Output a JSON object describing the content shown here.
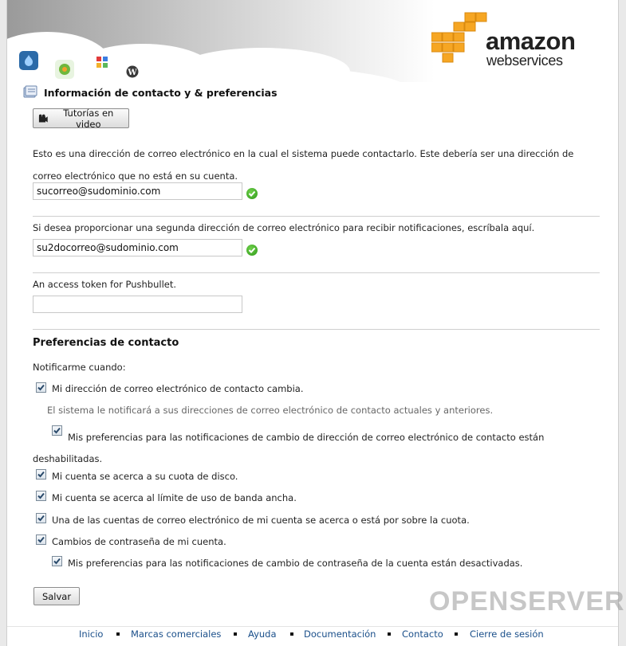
{
  "header": {
    "logo_word": "amazon",
    "logo_sub": "webservices",
    "app_icons": [
      "drupal-icon",
      "joomla-icon",
      "sugarcrm-icon",
      "wordpress-icon"
    ]
  },
  "section": {
    "title": "Información de contacto y & preferencias",
    "tutorial_button": "Tutorías en video"
  },
  "primary_email": {
    "description": "Esto es una dirección de correo electrónico en la cual el sistema puede contactarlo. Este debería ser una dirección de correo electrónico que no está en su cuenta.",
    "value": "sucorreo@sudominio.com"
  },
  "secondary_email": {
    "description": "Si desea proporcionar una segunda dirección de correo electrónico para recibir notificaciones, escríbala aquí.",
    "value": "su2docorreo@sudominio.com"
  },
  "pushbullet": {
    "label": "An access token for Pushbullet.",
    "value": ""
  },
  "preferences": {
    "heading": "Preferencias de contacto",
    "notify_label": "Notificarme cuando:",
    "contact_email_change": "Mi dirección de correo electrónico de contacto cambia.",
    "contact_email_note": "El sistema le notificará a sus direcciones de correo electrónico de contacto actuales y anteriores.",
    "contact_email_disabled": "Mis preferencias para las notificaciones de cambio de dirección de correo electrónico de contacto están deshabilitadas.",
    "disk_quota": "Mi cuenta se acerca a su cuota de disco.",
    "bandwidth": "Mi cuenta se acerca al límite de uso de banda ancha.",
    "email_quota": "Una de las cuentas de correo electrónico de mi cuenta se acerca o está por sobre la cuota.",
    "password_change": "Cambios de contraseña de mi cuenta.",
    "password_disabled": "Mis preferencias para las notificaciones de cambio de contraseña de la cuenta están desactivadas."
  },
  "save_button": "Salvar",
  "watermark": "OPENSERVER",
  "footer": {
    "links": [
      "Inicio",
      "Marcas comerciales",
      "Ayuda",
      "Documentación",
      "Contacto",
      "Cierre de sesión"
    ]
  }
}
